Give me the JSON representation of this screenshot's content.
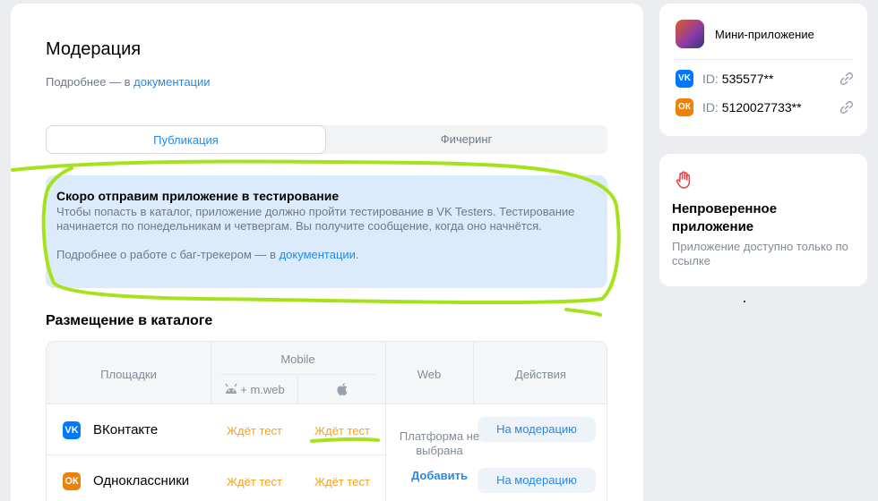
{
  "main": {
    "title": "Модерация",
    "subtitle_prefix": "Подробнее — в ",
    "subtitle_link": "документации",
    "tabs": [
      {
        "label": "Публикация",
        "active": true
      },
      {
        "label": "Фичеринг",
        "active": false
      }
    ]
  },
  "banner": {
    "title": "Скоро отправим приложение в тестирование",
    "text": "Чтобы попасть в каталог, приложение должно пройти тестирование в VK Testers. Тестирование начинается по понедельникам и четвергам. Вы получите сообщение, когда оно начнётся.",
    "more_prefix": "Подробнее о работе с баг-трекером — в ",
    "more_link": "документации",
    "more_suffix": "."
  },
  "catalog": {
    "title": "Размещение в каталоге",
    "headers": {
      "platforms": "Площадки",
      "mobile": "Mobile",
      "android_web": "+ m.web",
      "web": "Web",
      "actions": "Действия"
    },
    "rows": [
      {
        "platform": "ВКонтакте",
        "icon": "vk-logo-icon",
        "android_status": "Ждёт тест",
        "ios_status": "Ждёт тест",
        "action": "На модерацию"
      },
      {
        "platform": "Одноклассники",
        "icon": "ok-logo-icon",
        "android_status": "Ждёт тест",
        "ios_status": "Ждёт тест",
        "action": "На модерацию"
      }
    ],
    "web_status": "Платформа не выбрана",
    "web_add": "Добавить"
  },
  "app_card": {
    "name": "Мини-приложение",
    "ids": [
      {
        "icon": "vk-logo-icon",
        "label": "ID: ",
        "value": "535577**"
      },
      {
        "icon": "ok-logo-icon",
        "label": "ID: ",
        "value": "5120027733**"
      }
    ]
  },
  "status_card": {
    "icon": "raised-hand-icon",
    "title": "Непроверенное приложение",
    "text": "Приложение доступно только по ссылке"
  },
  "colors": {
    "accent": "#2688eb",
    "pending": "#f8a01c",
    "vk": "#0077ff",
    "ok": "#ee8208",
    "annotation": "#a6e21c",
    "danger": "#e64646"
  }
}
